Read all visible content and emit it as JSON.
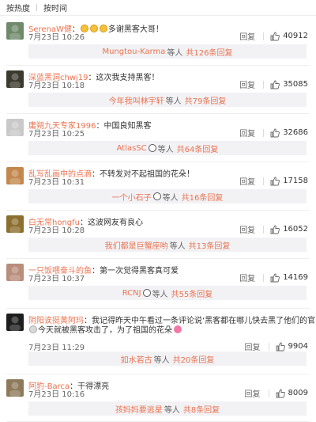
{
  "sort": {
    "hot": "按热度",
    "time": "按时间"
  },
  "labels": {
    "reply": "回复",
    "others": "等人",
    "total_prefix": "共",
    "total_suffix": "条回复"
  },
  "comments": [
    {
      "user": "SerenaW健",
      "text": "多谢黑客大哥！",
      "time": "7月23日 10:26",
      "likes": "40912",
      "reply_user": "Mungtou-Karma",
      "reply_count": "126",
      "avatar_color": "#6f8a6a"
    },
    {
      "user": "深蓝黑洞chwj19",
      "text": "这次我支持黑客！",
      "time": "7月23日 10:18",
      "likes": "35085",
      "reply_user": "今年我叫林宇轩",
      "reply_count": "79",
      "avatar_color": "#3a3a2e"
    },
    {
      "user": "庸朔九天专家1996",
      "text": "中国良知黑客",
      "time": "7月23日 10:25",
      "likes": "32686",
      "reply_user": "AtlasSC",
      "reply_count": "64",
      "avatar_color": "#c9c9c9"
    },
    {
      "user": "乱写乱画中的点滴",
      "text": "不转发对不起祖国的花朵！",
      "time": "7月23日 10:31",
      "likes": "17158",
      "reply_user": "一个小石子",
      "reply_count": "16",
      "avatar_color": "#c2874c"
    },
    {
      "user": "白无常hongfu",
      "text": "这波网友有良心",
      "time": "7月23日 10:28",
      "likes": "16052",
      "reply_user": "我们都是巨蟹座哟",
      "reply_count": "13",
      "avatar_color": "#8c6f2e"
    },
    {
      "user": "一只饭喂奋斗的鱼",
      "text": "第一次觉得黑客真可爱",
      "time": "7月23日 10:37",
      "likes": "14169",
      "reply_user": "RCNJ",
      "reply_count": "55",
      "avatar_color": "#b88d7a"
    },
    {
      "user": "阴阳诶挺黄阿玛",
      "text": "我记得昨天中午看过一条评论说‘黑客都在哪儿快去黑了他们的官网’",
      "text2": "今天就被黑客攻击了，为了祖国的花朵",
      "time": "7月23日 11:29",
      "likes": "9904",
      "reply_user": "如水若古",
      "reply_count": "20",
      "avatar_color": "#1e1e1e"
    },
    {
      "user": "阿豹-Barca",
      "text": "干得漂亮",
      "time": "7月23日 10:16",
      "likes": "8009",
      "reply_user": "孩妈妈要逃星",
      "reply_count": "8",
      "avatar_color": "#8d7a5a"
    }
  ]
}
